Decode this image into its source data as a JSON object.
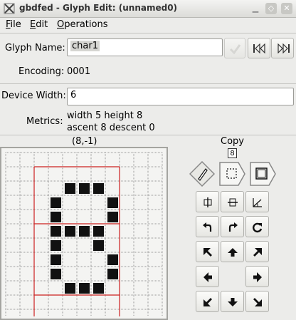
{
  "window": {
    "title": "gbdfed - Glyph Edit: (unnamed0)",
    "controls": [
      "minimize-icon",
      "maximize-icon",
      "close-icon"
    ]
  },
  "menubar": {
    "items": [
      {
        "label": "File",
        "mnemonic": "F",
        "rest": "ile"
      },
      {
        "label": "Edit",
        "mnemonic": "E",
        "rest": "dit"
      },
      {
        "label": "Operations",
        "mnemonic": "O",
        "rest": "perations"
      }
    ]
  },
  "glyph": {
    "name_label": "Glyph Name:",
    "name_value": "char1",
    "encoding_label": "Encoding:",
    "encoding_value": "0001",
    "device_width_label": "Device Width:",
    "device_width_value": "6",
    "metrics_label": "Metrics:",
    "metrics_line1": "width 5 height 8",
    "metrics_line2": "ascent 8 descent 0"
  },
  "editor": {
    "coordinate_readout": "(8,-1)",
    "copy_label": "Copy",
    "copy_glyph": "8",
    "bitmap": [
      "00000000000",
      "00000000000",
      "00001110000",
      "00010001000",
      "00010001000",
      "00011110000",
      "00010010000",
      "00010001000",
      "00010001000",
      "00001110000",
      "00000000000",
      "00000000000"
    ]
  },
  "tools": {
    "draw": "pencil-icon",
    "select": "selection-rectangle-icon",
    "copy": "copy-icon",
    "buttons": [
      "flip-horizontal-icon",
      "flip-vertical-icon",
      "shear-icon",
      "rotate-left-icon",
      "rotate-right-icon",
      "rotate-icon",
      "shift-up-left-icon",
      "shift-up-icon",
      "shift-up-right-icon",
      "shift-left-icon",
      "shift-right-icon",
      "shift-down-left-icon",
      "shift-down-icon",
      "shift-down-right-icon"
    ]
  },
  "colors": {
    "pixel_on": "#111111",
    "bbox_line": "#cc2020",
    "grid_line": "#9a9a9a"
  }
}
